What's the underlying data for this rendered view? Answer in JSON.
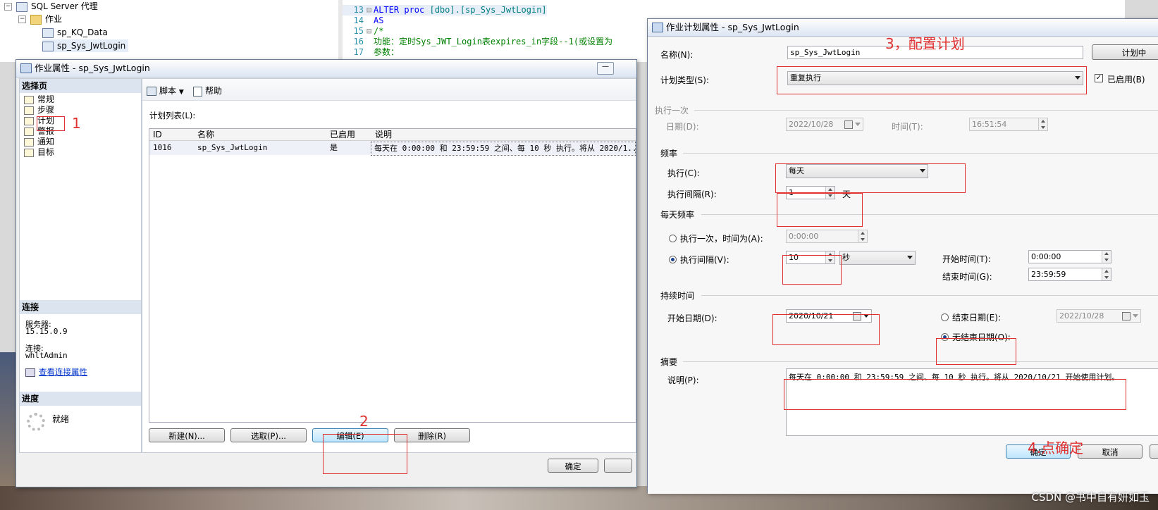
{
  "explorer": {
    "items": [
      {
        "label": "SQL Server 代理",
        "level": 0
      },
      {
        "label": "作业",
        "level": 1
      },
      {
        "label": "sp_KQ_Data",
        "level": 2
      },
      {
        "label": "sp_Sys_JwtLogin",
        "level": 2
      }
    ],
    "toggle_open": "−"
  },
  "editor": {
    "lines": [
      {
        "n": "13",
        "code_kw": "ALTER proc ",
        "code_obj": "[dbo].[sp_Sys_JwtLogin]",
        "cm": "",
        "fold": "⊟"
      },
      {
        "n": "14",
        "code_kw": "AS",
        "code_obj": "",
        "cm": "",
        "fold": ""
      },
      {
        "n": "15",
        "code_kw": "",
        "code_obj": "",
        "cm": "/*",
        "fold": "⊟"
      },
      {
        "n": "16",
        "code_kw": "",
        "code_obj": "",
        "cm": "功能：定时Sys_JWT_Login表expires_in字段--1(或设置为",
        "fold": ""
      },
      {
        "n": "17",
        "code_kw": "",
        "code_obj": "",
        "cm": "参数：",
        "fold": ""
      }
    ]
  },
  "job_dialog": {
    "title": "作业属性 - sp_Sys_JwtLogin",
    "select_page_header": "选择页",
    "pages": [
      "常规",
      "步骤",
      "计划",
      "警报",
      "通知",
      "目标"
    ],
    "connection_header": "连接",
    "server_label": "服务器:",
    "server_value": "15.15.0.9",
    "connect_label": "连接:",
    "connect_value": "whltAdmin",
    "view_conn_link": "查看连接属性",
    "progress_header": "进度",
    "progress_status": "就绪",
    "toolbar_script": "脚本",
    "toolbar_help": "帮助",
    "schedule_list_label": "计划列表(L):",
    "grid_columns": [
      "ID",
      "名称",
      "已启用",
      "说明"
    ],
    "grid_rows": [
      {
        "id": "1016",
        "name": "sp_Sys_JwtLogin",
        "enabled": "是",
        "desc": "每天在 0:00:00 和 23:59:59 之间、每 10 秒 执行。将从 2020/1..."
      }
    ],
    "btn_new": "新建(N)...",
    "btn_pick": "选取(P)...",
    "btn_edit": "编辑(E)",
    "btn_delete": "删除(R)",
    "btn_ok": "确定",
    "btn_min": "—"
  },
  "schedule_dialog": {
    "title": "作业计划属性 - sp_Sys_JwtLogin",
    "name_label": "名称(N):",
    "name_value": "sp_Sys_JwtLogin",
    "btn_schedule_jobs": "计划中",
    "type_label": "计划类型(S):",
    "type_value": "重复执行",
    "enabled_label": "已启用(B)",
    "enabled_mark": "✓",
    "once_section": "执行一次",
    "once_date_label": "日期(D):",
    "once_date_value": "2022/10/28",
    "once_time_label": "时间(T):",
    "once_time_value": "16:51:54",
    "freq_section": "频率",
    "occurs_label": "执行(C):",
    "occurs_value": "每天",
    "recurs_label": "执行间隔(R):",
    "recurs_value": "1",
    "recurs_unit": "天",
    "daily_section": "每天频率",
    "daily_once_label": "执行一次，时间为(A):",
    "daily_once_value": "0:00:00",
    "daily_every_label": "执行间隔(V):",
    "daily_every_value": "10",
    "daily_every_unit": "秒",
    "start_time_label": "开始时间(T):",
    "start_time_value": "0:00:00",
    "end_time_label": "结束时间(G):",
    "end_time_value": "23:59:59",
    "duration_section": "持续时间",
    "start_date_label": "开始日期(D):",
    "start_date_value": "2020/10/21",
    "end_date_label": "结束日期(E):",
    "end_date_value": "2022/10/28",
    "no_end_label": "无结束日期(O):",
    "summary_section": "摘要",
    "desc_label": "说明(P):",
    "desc_value": "每天在 0:00:00 和 23:59:59 之间、每 10 秒 执行。将从 2020/10/21 开始使用计划。",
    "btn_ok": "确定",
    "btn_cancel": "取消"
  },
  "annotations": {
    "a1": "1",
    "a2": "2",
    "a3": "3，配置计划",
    "a4": "4.点确定",
    "color": "#e03030"
  },
  "watermark": "CSDN @书中自有妍如玉"
}
